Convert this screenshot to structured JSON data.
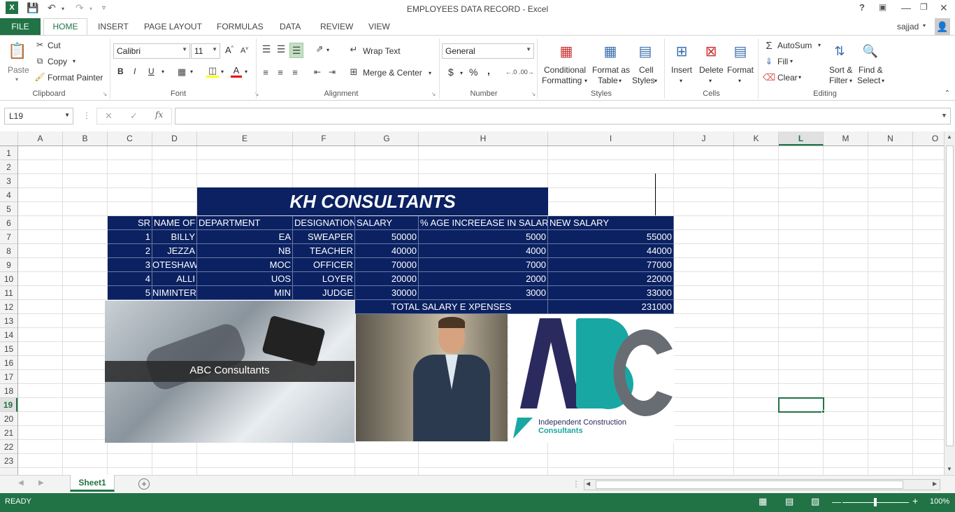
{
  "window": {
    "title": "EMPLOYEES DATA RECORD - Excel",
    "user": "sajjad",
    "help": "?"
  },
  "tabs": {
    "file": "FILE",
    "items": [
      "HOME",
      "INSERT",
      "PAGE LAYOUT",
      "FORMULAS",
      "DATA",
      "REVIEW",
      "VIEW"
    ]
  },
  "ribbon": {
    "clipboard": {
      "paste": "Paste",
      "cut": "Cut",
      "copy": "Copy",
      "format_painter": "Format Painter",
      "label": "Clipboard"
    },
    "font": {
      "name": "Calibri",
      "size": "11",
      "bold": "B",
      "italic": "I",
      "underline": "U",
      "label": "Font"
    },
    "alignment": {
      "wrap_text": "Wrap Text",
      "merge_center": "Merge & Center",
      "label": "Alignment"
    },
    "number": {
      "format": "General",
      "currency": "$",
      "percent": "%",
      "comma": ",",
      "label": "Number"
    },
    "styles": {
      "conditional_1": "Conditional",
      "conditional_2": "Formatting",
      "format_as_1": "Format as",
      "format_as_2": "Table",
      "cell_styles_1": "Cell",
      "cell_styles_2": "Styles",
      "label": "Styles"
    },
    "cells": {
      "insert": "Insert",
      "delete": "Delete",
      "format": "Format",
      "label": "Cells"
    },
    "editing": {
      "autosum": "AutoSum",
      "fill": "Fill",
      "clear": "Clear",
      "sort_1": "Sort &",
      "sort_2": "Filter",
      "find_1": "Find &",
      "find_2": "Select",
      "label": "Editing"
    }
  },
  "formula_bar": {
    "name_box": "L19",
    "fx": "fx",
    "formula": ""
  },
  "columns": [
    "A",
    "B",
    "C",
    "D",
    "E",
    "F",
    "G",
    "H",
    "I",
    "J",
    "K",
    "L",
    "M",
    "N",
    "O"
  ],
  "rows": [
    "1",
    "2",
    "3",
    "4",
    "5",
    "6",
    "7",
    "8",
    "9",
    "10",
    "11",
    "12",
    "13",
    "14",
    "15",
    "16",
    "17",
    "18",
    "19",
    "20",
    "21",
    "22",
    "23"
  ],
  "sheet": {
    "banner": "KH CONSULTANTS",
    "headers": [
      "SR",
      "NAME OF",
      "DEPARTMENT",
      "DESIGNATION",
      "SALARY",
      "% AGE INCREEASE IN SALARY",
      "NEW SALARY"
    ],
    "employees": [
      {
        "sr": "1",
        "name": "BILLY",
        "dept": "EA",
        "designation": "SWEAPER",
        "salary": "50000",
        "increase": "5000",
        "new_salary": "55000"
      },
      {
        "sr": "2",
        "name": "JEZZA",
        "dept": "NB",
        "designation": "TEACHER",
        "salary": "40000",
        "increase": "4000",
        "new_salary": "44000"
      },
      {
        "sr": "3",
        "name": "OTESHAW",
        "dept": "MOC",
        "designation": "OFFICER",
        "salary": "70000",
        "increase": "7000",
        "new_salary": "77000"
      },
      {
        "sr": "4",
        "name": "ALLI",
        "dept": "UOS",
        "designation": "LOYER",
        "salary": "20000",
        "increase": "2000",
        "new_salary": "22000"
      },
      {
        "sr": "5",
        "name": "NIMINTER",
        "dept": "MIN",
        "designation": "JUDGE",
        "salary": "30000",
        "increase": "3000",
        "new_salary": "33000"
      }
    ],
    "total_label": "TOTAL SALARY E XPENSES",
    "total_value": "231000",
    "image1_caption": "ABC Consultants",
    "logo_text": "ABC",
    "logo_sub1": "Independent Construction",
    "logo_sub2": "Consultants"
  },
  "sheet_tabs": {
    "active": "Sheet1"
  },
  "status": {
    "ready": "READY",
    "zoom": "100%"
  },
  "colors": {
    "excel_green": "#217346",
    "navy": "#0b2161",
    "logo_navy": "#2b2a5e",
    "logo_teal": "#19a7a3",
    "logo_gray": "#676d72"
  }
}
